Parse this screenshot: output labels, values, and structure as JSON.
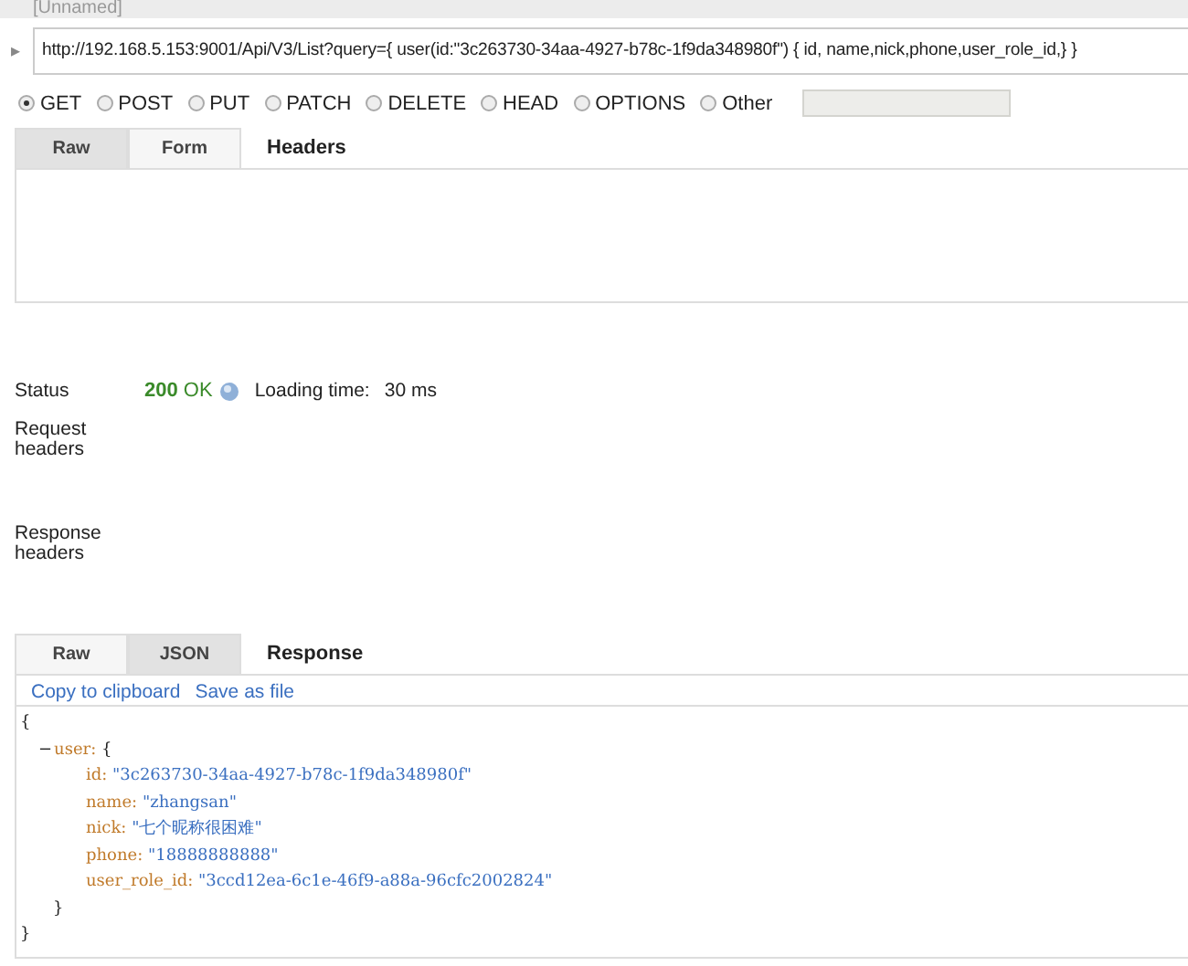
{
  "header": {
    "title": "[Unnamed]"
  },
  "request": {
    "toggle": "▸",
    "url": "http://192.168.5.153:9001/Api/V3/List?query={ user(id:\"3c263730-34aa-4927-b78c-1f9da348980f\") { id, name,nick,phone,user_role_id,} }",
    "methods": [
      {
        "label": "GET",
        "selected": true
      },
      {
        "label": "POST",
        "selected": false
      },
      {
        "label": "PUT",
        "selected": false
      },
      {
        "label": "PATCH",
        "selected": false
      },
      {
        "label": "DELETE",
        "selected": false
      },
      {
        "label": "HEAD",
        "selected": false
      },
      {
        "label": "OPTIONS",
        "selected": false
      },
      {
        "label": "Other",
        "selected": false
      }
    ],
    "tabs": [
      {
        "label": "Raw",
        "selected": true
      },
      {
        "label": "Form",
        "selected": false
      }
    ],
    "section_title": "Headers"
  },
  "status": {
    "label": "Status",
    "code": "200",
    "text": "OK",
    "loading_label": "Loading time:",
    "loading_value": "30 ms"
  },
  "request_headers": {
    "label": "Request headers"
  },
  "response_headers": {
    "label": "Response headers"
  },
  "response": {
    "tabs": [
      {
        "label": "Raw",
        "selected": false
      },
      {
        "label": "JSON",
        "selected": true
      }
    ],
    "section_title": "Response",
    "links": [
      "Copy to clipboard",
      "Save as file"
    ],
    "body": {
      "open": "{",
      "close": "}",
      "items": [
        {
          "toggle": "−",
          "key": "user:",
          "open": "{",
          "close": "}",
          "children": [
            {
              "key": "id:",
              "value": "\"3c263730-34aa-4927-b78c-1f9da348980f\""
            },
            {
              "key": "name:",
              "value": "\"zhangsan\""
            },
            {
              "key": "nick:",
              "value": "\"七个昵称很困难\""
            },
            {
              "key": "phone:",
              "value": "\"18888888888\""
            },
            {
              "key": "user_role_id:",
              "value": "\"3ccd12ea-6c1e-46f9-a88a-96cfc2002824\""
            }
          ]
        }
      ]
    }
  }
}
